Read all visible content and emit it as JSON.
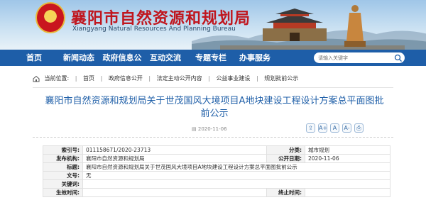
{
  "header": {
    "title": "襄阳市自然资源和规划局",
    "subtitle": "Xiangyang Natural Resources And Planning Bureau"
  },
  "nav": {
    "items": [
      "首页",
      "新闻动态",
      "政府信息公开",
      "互动交流",
      "专题专栏",
      "办事服务"
    ]
  },
  "search": {
    "placeholder": "请输入关键字"
  },
  "breadcrumb": {
    "label": "当前位置:",
    "items": [
      "首页",
      "政府信息公开",
      "法定主动公开内容",
      "公益事业建设",
      "规划批前公示"
    ]
  },
  "article": {
    "title": "襄阳市自然资源和规划局关于世茂国风大境项目A地块建设工程设计方案总平面图批前公示",
    "date": "2020-11-06"
  },
  "tools": [
    "share",
    "A+",
    "A",
    "A-",
    "print"
  ],
  "info": {
    "index_label": "索引号:",
    "index_value": "011158671/2020-23713",
    "category_label": "分类:",
    "category_value": "城市规划",
    "publisher_label": "发布机构:",
    "publisher_value": "襄阳市自然资源和规划局",
    "pubdate_label": "公开日期:",
    "pubdate_value": "2020-11-06",
    "title_label": "标题:",
    "title_value": "襄阳市自然资源和规划局关于世茂国风大境项目A地块建设工程设计方案总平面图批前公示",
    "docno_label": "文号:",
    "docno_value": "无",
    "keyword_label": "关键词:",
    "keyword_value": "",
    "effective_label": "生效时间:",
    "effective_value": "",
    "expiry_label": "终止时间:",
    "expiry_value": ""
  },
  "colors": {
    "nav_bg": "#1e5ea8",
    "title_red": "#c0161e",
    "article_blue": "#1f5fa8"
  }
}
